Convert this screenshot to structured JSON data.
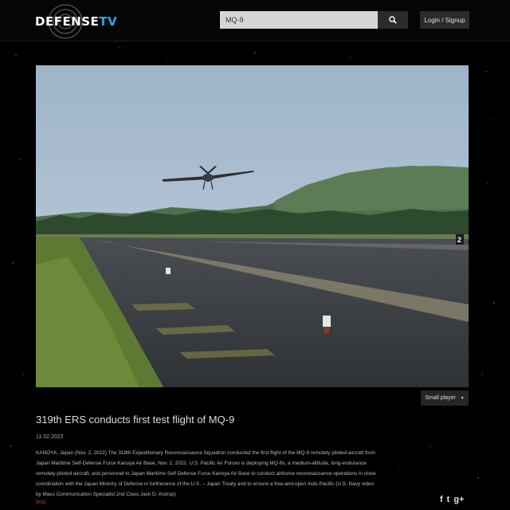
{
  "header": {
    "logo_text_main": "DEFENSE",
    "logo_text_accent": "TV",
    "search_value": "MQ-9",
    "search_icon": "search-icon",
    "login_label": "Login / Signup"
  },
  "video": {
    "runway_marker": "2",
    "small_player_label": "Small player",
    "caret_icon": "caret-down-icon"
  },
  "article": {
    "title": "319th ERS conducts first test flight of MQ-9",
    "date": "11.02.2022",
    "description": "KANOYA, Japan (Nov. 2, 2022) The 319th Expeditionary Reconnaissance Squadron conducted the first flight of the MQ-9 remotely piloted aircraft from Japan Maritime Self-Defense Force Kanoya Air Base, Nov. 2, 2022. U.S. Pacific Air Forces is deploying MQ-9s, a medium-altitude, long-endurance remotely piloted aircraft, and personnel to Japan Maritime Self Defense Force Kanoya Air Base to conduct airborne reconnaissance operations in close coordination with the Japan Ministry of Defense in furtherance of the U.S. – Japan Treaty and to ensure a free-and-open Indo-Pacific (U.S. Navy video by Mass Communication Specialist 2nd Class Jack D. Aistrup)",
    "less_label": "less"
  },
  "social": {
    "facebook": "f",
    "twitter": "t",
    "googleplus": "g+"
  },
  "colors": {
    "accent": "#2aa8e0",
    "link": "#c0392b",
    "background": "#000000"
  }
}
